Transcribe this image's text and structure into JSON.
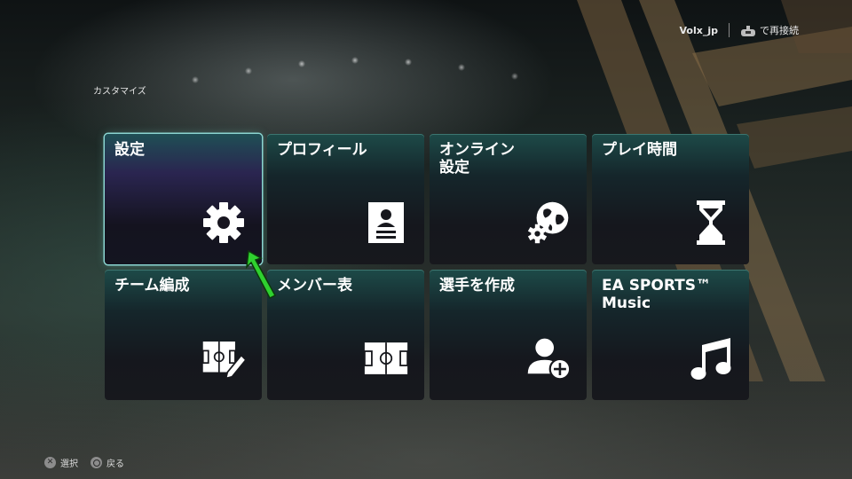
{
  "header": {
    "username": "Volx_jp",
    "reconnect_label": "で再接続",
    "page_title": "カスタマイズ"
  },
  "tiles": [
    {
      "label": "設定",
      "icon": "gear-icon",
      "selected": true
    },
    {
      "label": "プロフィール",
      "icon": "profile-card-icon",
      "selected": false
    },
    {
      "label": "オンライン\n設定",
      "icon": "globe-gear-icon",
      "selected": false
    },
    {
      "label": "プレイ時間",
      "icon": "hourglass-icon",
      "selected": false
    },
    {
      "label": "チーム編成",
      "icon": "tactics-board-edit-icon",
      "selected": false
    },
    {
      "label": "メンバー表",
      "icon": "pitch-icon",
      "selected": false
    },
    {
      "label": "選手を作成",
      "icon": "add-user-icon",
      "selected": false
    },
    {
      "label": "EA SPORTS™\nMusic",
      "icon": "music-note-icon",
      "selected": false
    }
  ],
  "footer": {
    "select_label": "選択",
    "back_label": "戻る"
  },
  "colors": {
    "selected_border": "#8ad4d0",
    "cursor_arrow": "#2fd12f"
  }
}
